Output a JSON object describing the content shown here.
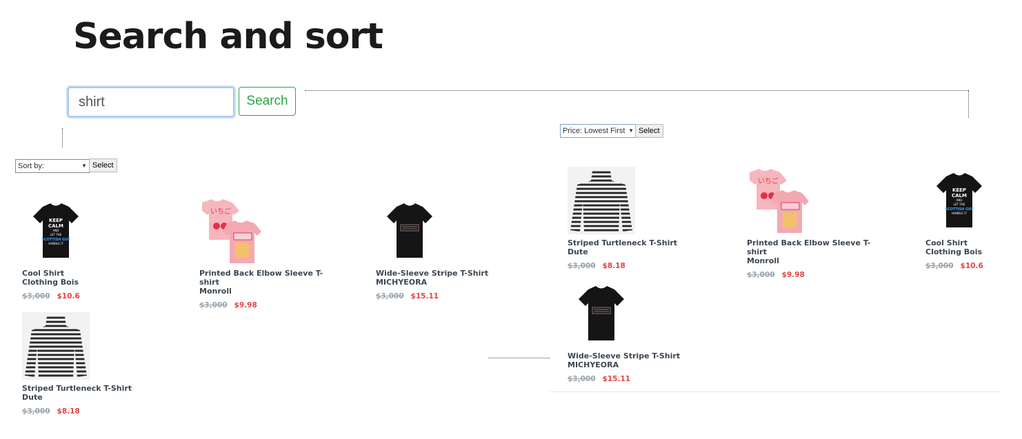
{
  "page": {
    "title": "Search and sort"
  },
  "search": {
    "value": "shirt",
    "button_label": "Search"
  },
  "left_panel": {
    "sort_select": {
      "selected": "Sort by:",
      "button_label": "Select"
    },
    "products": [
      {
        "name_line1": "Cool Shirt",
        "name_line2": "Clothing Bois",
        "old_price": "$3,000",
        "price": "$10.6",
        "image": "black-keep-calm-tshirt"
      },
      {
        "name_line1": "Printed Back Elbow Sleeve T-shirt",
        "name_line2": "Monroll",
        "old_price": "$3,000",
        "price": "$9.98",
        "image": "pink-strawberry-tshirt"
      },
      {
        "name_line1": "Wide-Sleeve Stripe T-Shirt",
        "name_line2": "MICHYEORA",
        "old_price": "$3,000",
        "price": "$15.11",
        "image": "black-stripe-tshirt"
      },
      {
        "name_line1": "Striped Turtleneck T-Shirt",
        "name_line2": "Dute",
        "old_price": "$3,000",
        "price": "$8.18",
        "image": "striped-turtleneck"
      }
    ]
  },
  "right_panel": {
    "sort_select": {
      "selected": "Price: Lowest First",
      "button_label": "Select"
    },
    "products": [
      {
        "name_line1": "Striped Turtleneck T-Shirt",
        "name_line2": "Dute",
        "old_price": "$3,000",
        "price": "$8.18",
        "image": "striped-turtleneck"
      },
      {
        "name_line1": "Printed Back Elbow Sleeve T-shirt",
        "name_line2": "Monroll",
        "old_price": "$3,000",
        "price": "$9.98",
        "image": "pink-strawberry-tshirt"
      },
      {
        "name_line1": "Cool Shirt",
        "name_line2": "Clothing Bois",
        "old_price": "$3,000",
        "price": "$10.6",
        "image": "black-keep-calm-tshirt"
      },
      {
        "name_line1": "Wide-Sleeve Stripe T-Shirt",
        "name_line2": "MICHYEORA",
        "old_price": "$3,000",
        "price": "$15.11",
        "image": "black-stripe-tshirt"
      }
    ]
  },
  "shirt_graphics": {
    "keep_calm_lines": [
      "KEEP",
      "CALM",
      "AND",
      "LET THE",
      "SCOTTISH GUY",
      "HANDLE IT"
    ],
    "strawberry_text": "いちご"
  },
  "colors": {
    "accent_green": "#28a745",
    "sale_red": "#e04545",
    "old_price_gray": "#9aa3ab"
  }
}
